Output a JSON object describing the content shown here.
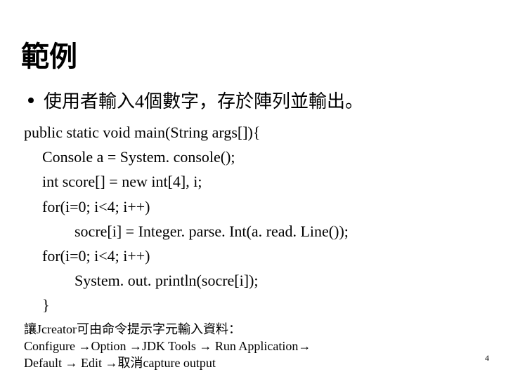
{
  "title": "範例",
  "bullet": "使用者輸入4個數字，存於陣列並輸出。",
  "code": {
    "l1": "public static void main(String args[]){",
    "l2": "Console a = System. console();",
    "l3": "int score[] = new int[4],  i;",
    "l4": "for(i=0; i<4; i++)",
    "l5": "socre[i] = Integer. parse. Int(a. read. Line());",
    "l6": "for(i=0; i<4; i++)",
    "l7": "System. out. println(socre[i]);",
    "l8": "}"
  },
  "note": {
    "n1": "讓Jcreator可由命令提示字元輸入資料：",
    "n2": "Configure →Option →JDK Tools → Run Application→",
    "n3": "Default → Edit →取消capture output"
  },
  "pagenum": "4"
}
